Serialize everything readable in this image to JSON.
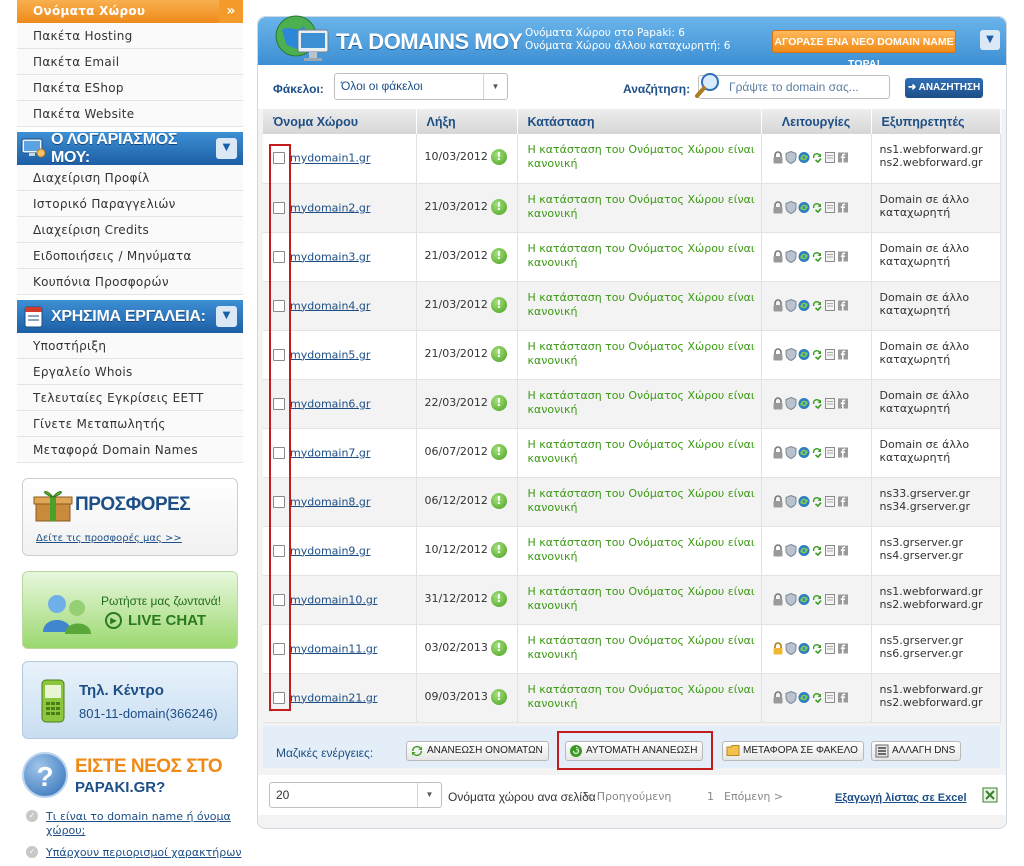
{
  "sidebar": {
    "top_items": [
      "Ονόματα Χώρου",
      "Πακέτα Hosting",
      "Πακέτα Email",
      "Πακέτα EShop",
      "Πακέτα Website"
    ],
    "active_index": 0,
    "account_header": "Ο ΛΟΓΑΡΙΑΣΜΟΣ ΜΟΥ:",
    "account_items": [
      "Διαχείριση Προφίλ",
      "Ιστορικό Παραγγελιών",
      "Διαχείριση Credits",
      "Ειδοποιήσεις / Μηνύματα",
      "Κουπόνια Προσφορών"
    ],
    "tools_header": "ΧΡΗΣΙΜΑ ΕΡΓΑΛΕΙΑ:",
    "tools_items": [
      "Υποστήριξη",
      "Εργαλείο Whois",
      "Τελευταίες Εγκρίσεις ΕΕΤΤ",
      "Γίνετε Μεταπωλητής",
      "Μεταφορά Domain Names"
    ],
    "offers": {
      "title": "ΠΡΟΣΦΟΡΕΣ",
      "link": "Δείτε τις προσφορές μας >>"
    },
    "live_chat": {
      "line1": "Ρωτήστε μας ζωντανά!",
      "line2": "LIVE CHAT"
    },
    "phone_center": {
      "title": "Τηλ. Κέντρο",
      "number": "801-11-domain(366246)"
    },
    "new_user": {
      "line1": "ΕΙΣΤΕ ΝΕΟΣ ΣΤΟ",
      "line2": "PAPAKI.GR?",
      "faq": [
        "Τι είναι το domain name ή όνομα χώρου;",
        "Υπάρχουν περιορισμοί χαρακτήρων"
      ]
    }
  },
  "main": {
    "banner": {
      "title": "ΤΑ DOMAINS ΜΟΥ",
      "stat1": "Ονόματα Χώρου στο Papaki: 6",
      "stat2": "Ονόματα Χώρου άλλου καταχωρητή: 6",
      "buy_button": "ΑΓΟΡΑΣΕ ΕΝΑ ΝΕΟ DOMAIN NAME ΤΩΡΑ!"
    },
    "filter": {
      "folders_label": "Φάκελοι:",
      "folders_value": "Όλοι οι φάκελοι",
      "search_label": "Αναζήτηση:",
      "search_placeholder": "Γράψτε το domain σας...",
      "search_button": "➜ ΑΝΑΖΗΤΗΣΗ"
    },
    "table": {
      "headers": [
        "Όνομα Χώρου",
        "Λήξη",
        "Κατάσταση",
        "Λειτουργίες",
        "Εξυπηρετητές"
      ],
      "rows": [
        {
          "domain": "mydomain1.gr",
          "expiry": "10/03/2012",
          "status": "Η κατάσταση του Ονόματος Χώρου είναι κανονική",
          "ns1": "ns1.webforward.gr",
          "ns2": "ns2.webforward.gr",
          "lock": "grey"
        },
        {
          "domain": "mydomain2.gr",
          "expiry": "21/03/2012",
          "status": "Η κατάσταση του Ονόματος Χώρου είναι κανονική",
          "ns1": "Domain σε άλλο",
          "ns2": "καταχωρητή",
          "lock": "grey"
        },
        {
          "domain": "mydomain3.gr",
          "expiry": "21/03/2012",
          "status": "Η κατάσταση του Ονόματος Χώρου είναι κανονική",
          "ns1": "Domain σε άλλο",
          "ns2": "καταχωρητή",
          "lock": "grey"
        },
        {
          "domain": "mydomain4.gr",
          "expiry": "21/03/2012",
          "status": "Η κατάσταση του Ονόματος Χώρου είναι κανονική",
          "ns1": "Domain σε άλλο",
          "ns2": "καταχωρητή",
          "lock": "grey"
        },
        {
          "domain": "mydomain5.gr",
          "expiry": "21/03/2012",
          "status": "Η κατάσταση του Ονόματος Χώρου είναι κανονική",
          "ns1": "Domain σε άλλο",
          "ns2": "καταχωρητή",
          "lock": "grey"
        },
        {
          "domain": "mydomain6.gr",
          "expiry": "22/03/2012",
          "status": "Η κατάσταση του Ονόματος Χώρου είναι κανονική",
          "ns1": "Domain σε άλλο",
          "ns2": "καταχωρητή",
          "lock": "grey"
        },
        {
          "domain": "mydomain7.gr",
          "expiry": "06/07/2012",
          "status": "Η κατάσταση του Ονόματος Χώρου είναι κανονική",
          "ns1": "Domain σε άλλο",
          "ns2": "καταχωρητή",
          "lock": "grey"
        },
        {
          "domain": "mydomain8.gr",
          "expiry": "06/12/2012",
          "status": "Η κατάσταση του Ονόματος Χώρου είναι κανονική",
          "ns1": "ns33.grserver.gr",
          "ns2": "ns34.grserver.gr",
          "lock": "grey"
        },
        {
          "domain": "mydomain9.gr",
          "expiry": "10/12/2012",
          "status": "Η κατάσταση του Ονόματος Χώρου είναι κανονική",
          "ns1": "ns3.grserver.gr",
          "ns2": "ns4.grserver.gr",
          "lock": "grey"
        },
        {
          "domain": "mydomain10.gr",
          "expiry": "31/12/2012",
          "status": "Η κατάσταση του Ονόματος Χώρου είναι κανονική",
          "ns1": "ns1.webforward.gr",
          "ns2": "ns2.webforward.gr",
          "lock": "grey"
        },
        {
          "domain": "mydomain11.gr",
          "expiry": "03/02/2013",
          "status": "Η κατάσταση του Ονόματος Χώρου είναι κανονική",
          "ns1": "ns5.grserver.gr",
          "ns2": "ns6.grserver.gr",
          "lock": "gold"
        },
        {
          "domain": "mydomain21.gr",
          "expiry": "09/03/2013",
          "status": "Η κατάσταση του Ονόματος Χώρου είναι κανονική",
          "ns1": "ns1.webforward.gr",
          "ns2": "ns2.webforward.gr",
          "lock": "grey"
        }
      ]
    },
    "bulk": {
      "label": "Μαζικές ενέργειες:",
      "buttons": [
        "ΑΝΑΝΕΩΣΗ ΟΝΟΜΑΤΩΝ",
        "ΑΥΤΟΜΑΤΗ ΑΝΑΝΕΩΣΗ",
        "ΜΕΤΑΦΟΡΑ ΣΕ ΦΑΚΕΛΟ",
        "ΑΛΛΑΓΗ DNS"
      ]
    },
    "pager": {
      "per_page": "20",
      "per_page_label": "Ονόματα χώρου ανα σελίδα",
      "prev": "< Προηγούμενη",
      "page": "1",
      "next": "Επόμενη >",
      "export": "Εξαγωγή λίστας σε Excel"
    }
  },
  "colors": {
    "accent_orange": "#ee8a1a",
    "header_blue": "#3d8fd4",
    "link_blue": "#1d4f86",
    "status_green": "#3c9a14",
    "highlight_red": "#c31c1c"
  },
  "icons": [
    "globe-monitor-icon",
    "gift-box-icon",
    "people-chat-icon",
    "mobile-phone-icon",
    "help-question-icon",
    "lock-icon",
    "shield-icon",
    "sync-icon",
    "refresh-icon",
    "note-icon",
    "facebook-icon",
    "magnifier-icon",
    "excel-icon",
    "folder-icon",
    "dns-icon"
  ]
}
